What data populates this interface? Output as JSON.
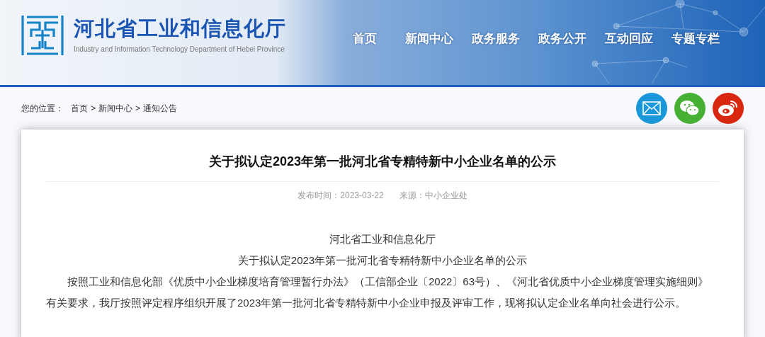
{
  "header": {
    "title": "河北省工业和信息化厅",
    "subtitle": "Industry and Information Technology Department of Hebei Province",
    "nav": [
      {
        "label": "首页"
      },
      {
        "label": "新闻中心"
      },
      {
        "label": "政务服务"
      },
      {
        "label": "政务公开"
      },
      {
        "label": "互动回应"
      },
      {
        "label": "专题专栏"
      }
    ]
  },
  "breadcrumb": {
    "label": "您的位置：",
    "items": [
      "首页",
      "新闻中心",
      "通知公告"
    ],
    "separator": ">"
  },
  "share": [
    {
      "kind": "mail",
      "color": "#1a97d9"
    },
    {
      "kind": "wechat",
      "color": "#46b035"
    },
    {
      "kind": "weibo",
      "color": "#d8260f"
    }
  ],
  "article": {
    "title": "关于拟认定2023年第一批河北省专精特新中小企业名单的公示",
    "published": "发布时间：2023-03-22",
    "source": "来源：中小企业处",
    "lines": [
      "河北省工业和信息化厅",
      "关于拟认定2023年第一批河北省专精特新中小企业名单的公示"
    ],
    "paragraph": "按照工业和信息化部《优质中小企业梯度培育管理暂行办法》（工信部企业〔2022〕63号）、《河北省优质中小企业梯度管理实施细则》有关要求，我厅按照评定程序组织开展了2023年第一批河北省专精特新中小企业申报及评审工作，现将拟认定企业名单向社会进行公示。"
  }
}
